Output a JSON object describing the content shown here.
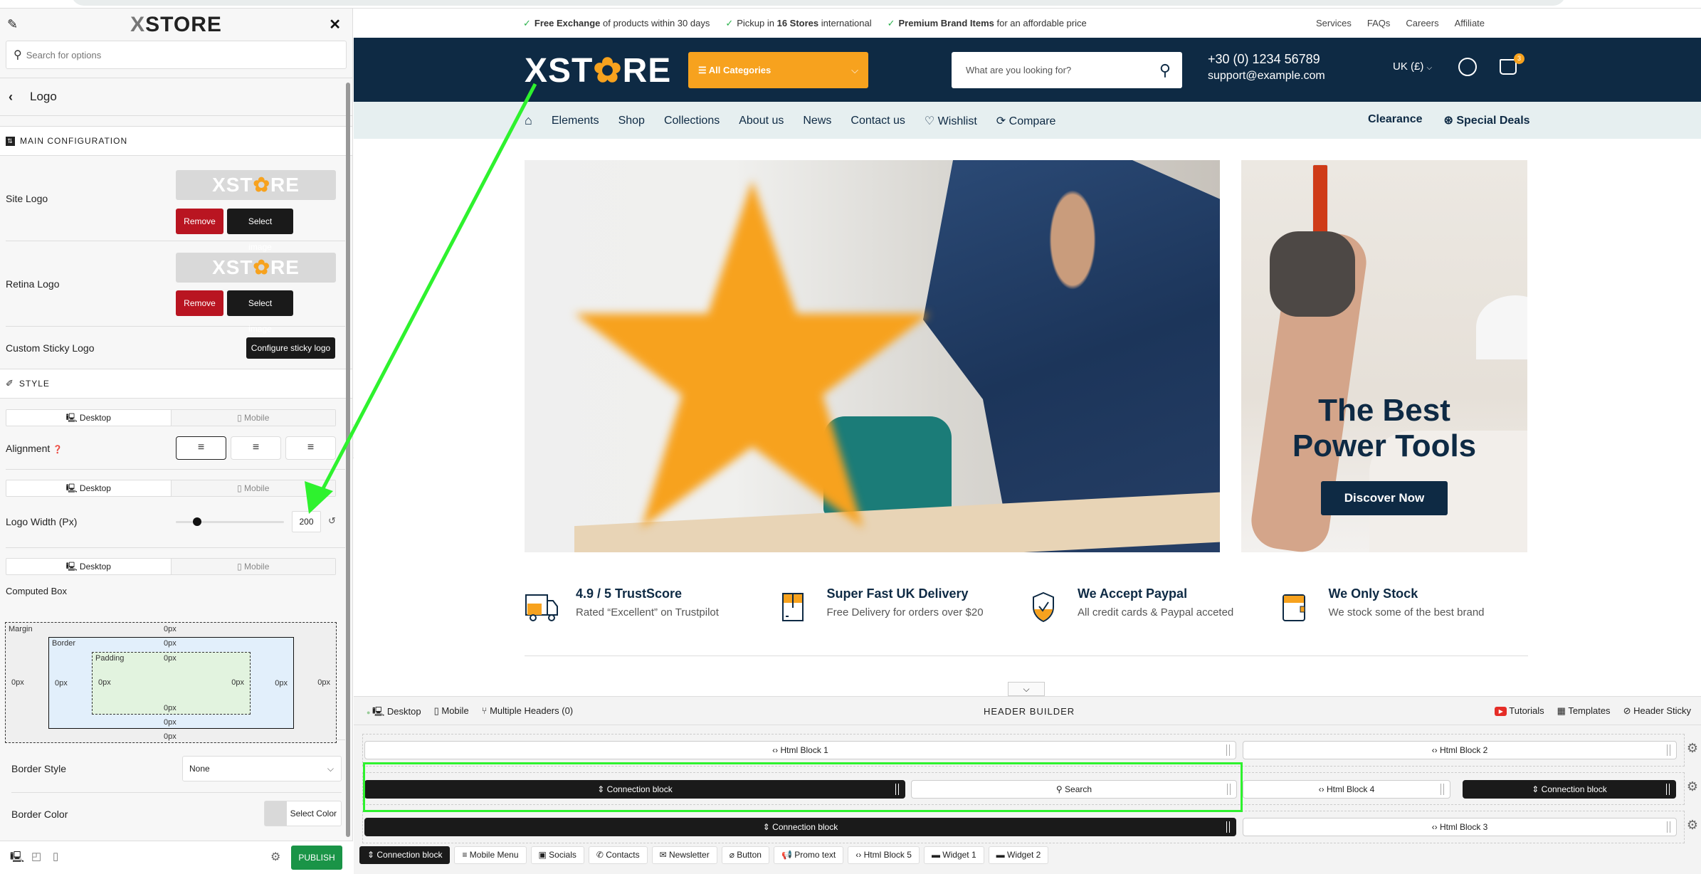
{
  "sidebar": {
    "brand": {
      "prefix": "X",
      "name": "STORE"
    },
    "search_placeholder": "Search for options",
    "back_title": "Logo",
    "main_config_title": "MAIN CONFIGURATION",
    "site_logo_label": "Site Logo",
    "retina_logo_label": "Retina Logo",
    "logo_preview_text": {
      "left": "XST",
      "gear": "✿",
      "right": "RE"
    },
    "remove_label": "Remove",
    "select_image_label": "Select image",
    "custom_sticky_label": "Custom Sticky Logo",
    "configure_sticky_label": "Configure sticky logo",
    "style_title": "STYLE",
    "desktop_label": "Desktop",
    "mobile_label": "Mobile",
    "alignment_label": "Alignment",
    "alignment_selected": "left",
    "logo_width_label": "Logo Width (Px)",
    "logo_width_value": "200",
    "logo_width_slider_fraction": 0.2,
    "computed_box_label": "Computed Box",
    "box": {
      "margin_label": "Margin",
      "border_label": "Border",
      "padding_label": "Padding",
      "value": "0px"
    },
    "border_style_label": "Border Style",
    "border_style_value": "None",
    "border_color_label": "Border Color",
    "select_color_label": "Select Color",
    "publish_label": "PUBLISH"
  },
  "site": {
    "promos": [
      {
        "bold": "Free Exchange",
        "rest": " of products within 30 days"
      },
      {
        "pre": "Pickup in ",
        "bold": "16 Stores",
        "rest": " international"
      },
      {
        "bold": "Premium Brand Items",
        "rest": " for an affordable price"
      }
    ],
    "top_links": [
      "Services",
      "FAQs",
      "Careers",
      "Affiliate"
    ],
    "logo": {
      "left": "XST",
      "right": "RE"
    },
    "all_categories": "All Categories",
    "search_placeholder": "What are you looking for?",
    "phone": "+30 (0) 1234 56789",
    "email": "support@example.com",
    "locale": "UK (£)",
    "cart_count": "3",
    "nav": [
      "Elements",
      "Shop",
      "Collections",
      "About us",
      "News",
      "Contact us"
    ],
    "wishlist": "Wishlist",
    "compare": "Compare",
    "nav_right": [
      "Clearance",
      "Special Deals"
    ],
    "hero2_title_line1": "The Best",
    "hero2_title_line2": "Power Tools",
    "hero2_button": "Discover Now",
    "features": [
      {
        "title": "4.9 / 5 TrustScore",
        "sub": "Rated “Excellent” on Trustpilot",
        "icon": "truck-icon"
      },
      {
        "title": "Super Fast UK Delivery",
        "sub": "Free Delivery for orders over $20",
        "icon": "box-icon"
      },
      {
        "title": "We Accept Paypal",
        "sub": "All credit cards & Paypal acceted",
        "icon": "shield-check-icon"
      },
      {
        "title": "We Only Stock",
        "sub": "We stock some of the best brand",
        "icon": "wallet-icon"
      }
    ],
    "accent_color": "#f7a21e",
    "brand_dark": "#0e2a44"
  },
  "header_builder": {
    "title": "HEADER BUILDER",
    "desktop": "Desktop",
    "mobile": "Mobile",
    "multiple_headers": "Multiple Headers (0)",
    "tutorials": "Tutorials",
    "templates": "Templates",
    "header_sticky": "Header Sticky",
    "row1": {
      "left": "Html Block 1",
      "right": "Html Block 2"
    },
    "row2": {
      "a": "Connection block",
      "b": "Search",
      "c": "Html Block 4",
      "d": "Connection block"
    },
    "row3": {
      "left": "Connection block",
      "right": "Html Block 3"
    },
    "toolbox": [
      "Connection block",
      "Mobile Menu",
      "Socials",
      "Contacts",
      "Newsletter",
      "Button",
      "Promo text",
      "Html Block 5",
      "Widget 1",
      "Widget 2"
    ]
  }
}
